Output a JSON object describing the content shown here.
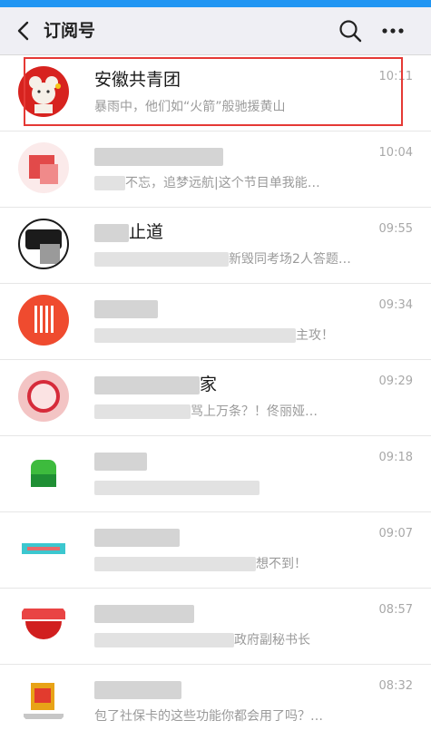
{
  "header": {
    "title": "订阅号"
  },
  "items": [
    {
      "name": "安徽共青团",
      "preview": "暴雨中，他们如“火箭”般驰援黄山",
      "time": "10:11",
      "highlighted": true
    },
    {
      "name": "",
      "preview": "不忘，追梦远航|这个节目单我能…",
      "time": "10:04"
    },
    {
      "name": "止道",
      "preview": "新毁同考场2人答题…",
      "time": "09:55"
    },
    {
      "name": "",
      "preview": "主攻！",
      "time": "09:34"
    },
    {
      "name": "家",
      "preview": "骂上万条？！佟丽娅…",
      "time": "09:29"
    },
    {
      "name": "",
      "preview": "",
      "time": "09:18"
    },
    {
      "name": "",
      "preview": "想不到！",
      "time": "09:07"
    },
    {
      "name": "",
      "preview": "政府副秘书长",
      "time": "08:57"
    },
    {
      "name": "",
      "preview": "包了社保卡的这些功能你都会用了吗？…",
      "time": "08:32"
    }
  ]
}
